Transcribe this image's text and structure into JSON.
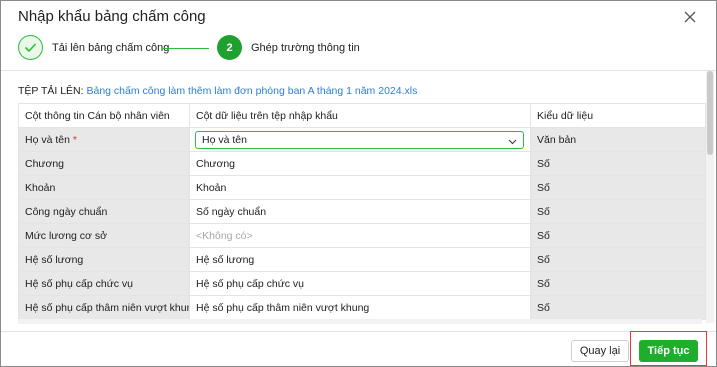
{
  "dialog": {
    "title": "Nhập khẩu bảng chấm công"
  },
  "steps": [
    {
      "number": "",
      "label": "Tải lên bảng chấm công",
      "state": "done"
    },
    {
      "number": "2",
      "label": "Ghép trường thông tin",
      "state": "active"
    }
  ],
  "file": {
    "label": "TỆP TẢI LÊN:",
    "name": "Bảng chấm công làm thêm làm đơn phòng ban A tháng 1 năm 2024.xls"
  },
  "table": {
    "headers": [
      "Cột thông tin Cán bộ nhân viên",
      "Cột dữ liệu trên tệp nhập khẩu",
      "Kiểu dữ liệu"
    ],
    "rows": [
      {
        "field": "Họ và tên",
        "required_mark": "*",
        "source": "Họ và tên",
        "type": "Văn bản"
      },
      {
        "field": "Chương",
        "source": "Chương",
        "type": "Số"
      },
      {
        "field": "Khoản",
        "source": "Khoản",
        "type": "Số"
      },
      {
        "field": "Công ngày chuẩn",
        "source": "Số ngày chuẩn",
        "type": "Số"
      },
      {
        "field": "Mức lương cơ sở",
        "source": "<Không có>",
        "type": "Số"
      },
      {
        "field": "Hệ số lương",
        "source": "Hệ số lương",
        "type": "Số"
      },
      {
        "field": "Hệ số phụ cấp chức vụ",
        "source": "Hệ số phụ cấp chức vụ",
        "type": "Số"
      },
      {
        "field": "Hệ số phụ cấp thâm niên vượt khung",
        "source": "Hệ số phụ cấp thâm niên vượt khung",
        "type": "Số"
      }
    ]
  },
  "footer": {
    "back_label": "Quay lại",
    "next_label": "Tiếp tục"
  },
  "colors": {
    "accent": "#1fae2b",
    "link": "#2b7fd4",
    "required": "#e0312d",
    "highlight": "#e33a3a"
  }
}
